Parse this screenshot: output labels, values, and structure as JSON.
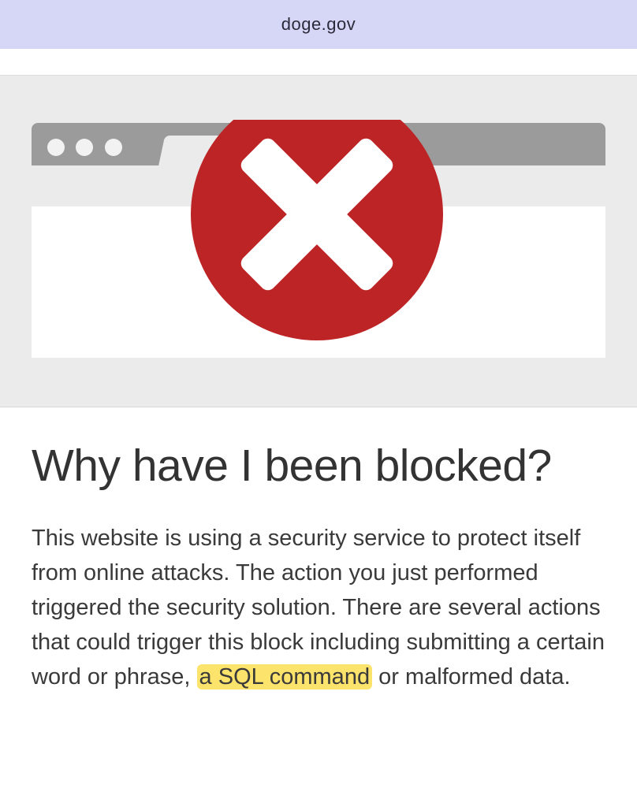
{
  "url_bar": {
    "domain": "doge.gov"
  },
  "illustration": {
    "icon": "error-x-icon",
    "circle_color": "#bd2426",
    "x_color": "#ffffff",
    "browser_frame_color": "#9b9b9b"
  },
  "main": {
    "title": "Why have I been blocked?",
    "body_part1": "This website is using a security service to protect itself from online attacks. The action you just performed triggered the security solution. There are several actions that could trigger this block including submitting a certain word or phrase, ",
    "body_highlight": "a SQL command",
    "body_part2": " or malformed data."
  },
  "colors": {
    "url_bar_bg": "#d6d6f7",
    "highlight": "#fce36b",
    "text": "#3a3a3a"
  }
}
